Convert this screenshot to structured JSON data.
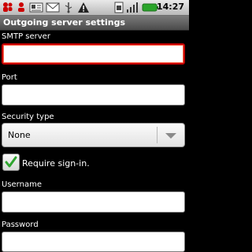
{
  "status_bar": {
    "time": "14:27",
    "icons": [
      "people-icon",
      "voicemail-icon",
      "newspaper-icon",
      "gmail-icon",
      "usb-icon",
      "warning-icon",
      "sim-icon",
      "signal-icon",
      "battery-icon"
    ]
  },
  "title_bar": {
    "title": "Outgoing server settings"
  },
  "form": {
    "smtp_server_label": "SMTP server",
    "port_label": "Port",
    "security_type_label": "Security type",
    "security_type_value": "None",
    "require_signin_label": "Require sign-in.",
    "require_signin_checked": true,
    "username_label": "Username",
    "password_label": "Password"
  },
  "colors": {
    "focus": "#c40000",
    "check": "#2fa52f"
  }
}
